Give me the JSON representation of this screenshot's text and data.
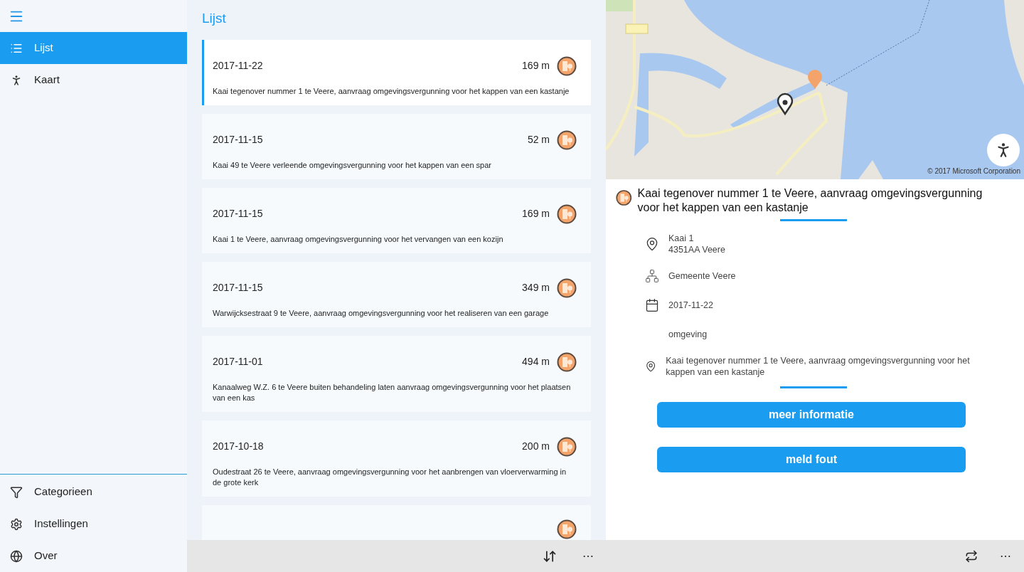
{
  "nav": {
    "items": [
      {
        "label": "Lijst",
        "kind": "list",
        "selected": true
      },
      {
        "label": "Kaart",
        "kind": "map",
        "selected": false
      }
    ],
    "bottom_items": [
      {
        "label": "Categorieen",
        "kind": "filter"
      },
      {
        "label": "Instellingen",
        "kind": "settings"
      },
      {
        "label": "Over",
        "kind": "globe"
      }
    ]
  },
  "list": {
    "title": "Lijst",
    "items": [
      {
        "date": "2017-11-22",
        "distance": "169 m",
        "description": "Kaai tegenover nummer 1 te Veere, aanvraag omgevingsvergunning voor het kappen van een kastanje",
        "selected": true
      },
      {
        "date": "2017-11-15",
        "distance": "52 m",
        "description": "Kaai 49 te Veere verleende omgevingsvergunning voor het kappen van een spar",
        "selected": false
      },
      {
        "date": "2017-11-15",
        "distance": "169 m",
        "description": "Kaai 1 te Veere, aanvraag omgevingsvergunning voor het vervangen van een kozijn",
        "selected": false
      },
      {
        "date": "2017-11-15",
        "distance": "349 m",
        "description": "Warwijcksestraat 9 te Veere, aanvraag omgevingsvergunning voor het realiseren van een garage",
        "selected": false
      },
      {
        "date": "2017-11-01",
        "distance": "494 m",
        "description": "Kanaalweg W.Z. 6 te Veere buiten behandeling laten aanvraag omgevingsvergunning voor het plaatsen van een kas",
        "selected": false
      },
      {
        "date": "2017-10-18",
        "distance": "200 m",
        "description": "Oudestraat 26 te Veere, aanvraag omgevingsvergunning voor het aanbrengen van vloerverwarming in de grote kerk",
        "selected": false
      },
      {
        "selected": false
      }
    ]
  },
  "map": {
    "kind": "picture",
    "copyright": "© 2017 Microsoft Corporation"
  },
  "detail": {
    "title": "Kaai tegenover nummer 1 te Veere, aanvraag omgevingsvergunning voor het kappen van een kastanje",
    "rows": [
      {
        "kind": "address",
        "lines": [
          "Kaai 1",
          "4351AA Veere"
        ]
      },
      {
        "kind": "organization",
        "lines": [
          "Gemeente Veere"
        ]
      },
      {
        "kind": "date",
        "lines": [
          "2017-11-22"
        ]
      },
      {
        "kind": "category",
        "lines": [
          "omgeving"
        ]
      },
      {
        "kind": "location",
        "lines": [
          "Kaai tegenover nummer 1 te Veere, aanvraag omgevingsvergunning voor het kappen van een kastanje"
        ]
      }
    ],
    "buttons": [
      "meer informatie",
      "meld fout"
    ]
  },
  "command_bar": {
    "center": [
      "⋯"
    ],
    "right": [
      "⋯"
    ]
  }
}
